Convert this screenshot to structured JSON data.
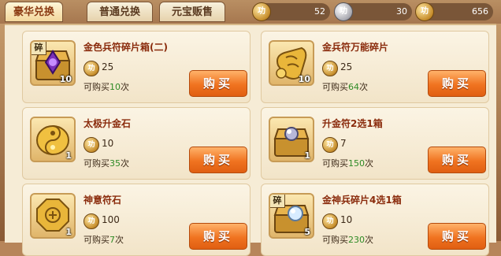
{
  "tabs": [
    {
      "label": "豪华兑换",
      "active": true
    },
    {
      "label": "普通兑换",
      "active": false
    },
    {
      "label": "元宝贩售",
      "active": false
    }
  ],
  "currencies": [
    {
      "icon": "gold-token-icon",
      "glyph": "功",
      "value": "52"
    },
    {
      "icon": "silver-token-icon",
      "glyph": "功",
      "value": "30"
    },
    {
      "icon": "gold-token-icon",
      "glyph": "功",
      "value": "656"
    }
  ],
  "limit_prefix": "可购买",
  "limit_suffix": "次",
  "buy_label": "购买",
  "price_glyph": "功",
  "shard_tag": "碎",
  "items": [
    {
      "name": "金色兵符碎片箱(二)",
      "price": "25",
      "limit": "10",
      "qty": "10",
      "icon": "purple-shard-chest-icon"
    },
    {
      "name": "金兵符万能碎片",
      "price": "25",
      "limit": "64",
      "qty": "10",
      "icon": "gold-talisman-shard-icon"
    },
    {
      "name": "太极升金石",
      "price": "10",
      "limit": "35",
      "qty": "1",
      "icon": "taiji-gold-stone-icon"
    },
    {
      "name": "升金符2选1箱",
      "price": "7",
      "limit": "150",
      "qty": "1",
      "icon": "silver-gem-chest-icon"
    },
    {
      "name": "神意符石",
      "price": "100",
      "limit": "7",
      "qty": "1",
      "icon": "octagon-talisman-stone-icon"
    },
    {
      "name": "金神兵碎片4选1箱",
      "price": "10",
      "limit": "230",
      "qty": "5",
      "icon": "crystal-shard-chest-icon"
    }
  ]
}
